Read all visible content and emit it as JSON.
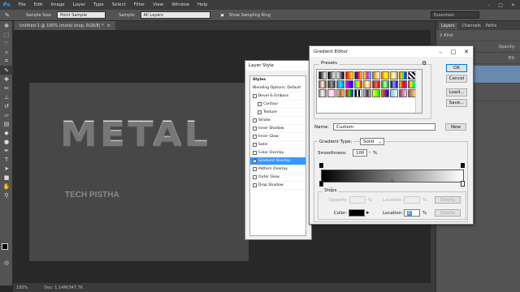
{
  "app": {
    "logo": "Ps"
  },
  "menu": [
    "File",
    "Edit",
    "Image",
    "Layer",
    "Type",
    "Select",
    "Filter",
    "View",
    "Window",
    "Help"
  ],
  "options_bar": {
    "sample_size_label": "Sample Size:",
    "sample_size_value": "Point Sample",
    "sample_label": "Sample:",
    "sample_value": "All Layers",
    "show_ring_label": "Show Sampling Ring",
    "workspace": "Essentials"
  },
  "document": {
    "tab_title": "Untitled-1 @ 100% (metal shop, RGB/8) *",
    "main_text": "METAL",
    "sub_text": "TECH PISTHA"
  },
  "status_bar": {
    "zoom": "100%",
    "doc": "Doc: 1.14M/347.7K"
  },
  "right_panel": {
    "tabs": [
      "Layers",
      "Channels",
      "Paths"
    ],
    "kind_label": "Kind",
    "opacity_label": "Opacity:",
    "fill_label": "Fill:"
  },
  "layer_style": {
    "title": "Layer Style",
    "header": "Styles",
    "items": [
      {
        "label": "Blending Options: Default",
        "checkbox": false,
        "checked": false,
        "sub": false,
        "selected": false
      },
      {
        "label": "Bevel & Emboss",
        "checkbox": true,
        "checked": false,
        "sub": false,
        "selected": false
      },
      {
        "label": "Contour",
        "checkbox": true,
        "checked": false,
        "sub": true,
        "selected": false
      },
      {
        "label": "Texture",
        "checkbox": true,
        "checked": false,
        "sub": true,
        "selected": false
      },
      {
        "label": "Stroke",
        "checkbox": true,
        "checked": false,
        "sub": false,
        "selected": false
      },
      {
        "label": "Inner Shadow",
        "checkbox": true,
        "checked": false,
        "sub": false,
        "selected": false
      },
      {
        "label": "Inner Glow",
        "checkbox": true,
        "checked": false,
        "sub": false,
        "selected": false
      },
      {
        "label": "Satin",
        "checkbox": true,
        "checked": false,
        "sub": false,
        "selected": false
      },
      {
        "label": "Color Overlay",
        "checkbox": true,
        "checked": false,
        "sub": false,
        "selected": false
      },
      {
        "label": "Gradient Overlay",
        "checkbox": true,
        "checked": true,
        "sub": false,
        "selected": true
      },
      {
        "label": "Pattern Overlay",
        "checkbox": true,
        "checked": false,
        "sub": false,
        "selected": false
      },
      {
        "label": "Outer Glow",
        "checkbox": true,
        "checked": false,
        "sub": false,
        "selected": false
      },
      {
        "label": "Drop Shadow",
        "checkbox": true,
        "checked": false,
        "sub": false,
        "selected": false
      }
    ]
  },
  "gradient_editor": {
    "title": "Gradient Editor",
    "presets_label": "Presets",
    "ok": "OK",
    "cancel": "Cancel",
    "load": "Load...",
    "save": "Save...",
    "name_label": "Name:",
    "name_value": "Custom",
    "new_button": "New",
    "gradient_type_label": "Gradient Type:",
    "gradient_type_value": "Solid",
    "smoothness_label": "Smoothness:",
    "smoothness_value": "100",
    "percent": "%",
    "stops_label": "Stops",
    "opacity_label": "Opacity:",
    "location_label": "Location:",
    "delete_label": "Delete",
    "color_label": "Color:",
    "location_value": "0",
    "color_value": "#000000"
  }
}
